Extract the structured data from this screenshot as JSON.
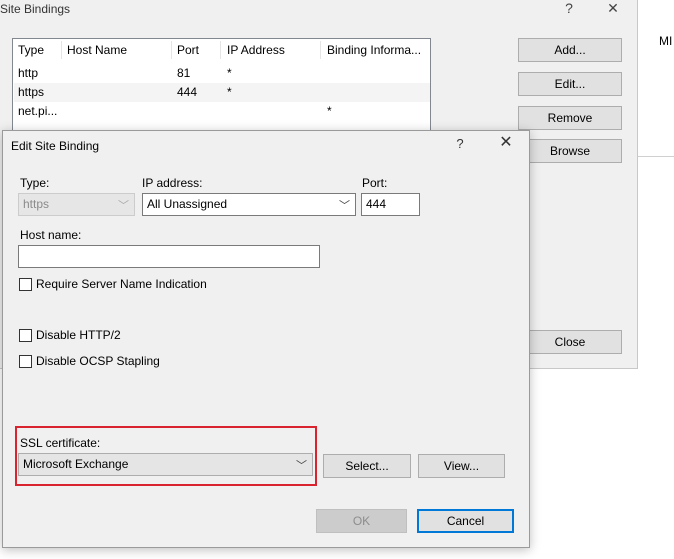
{
  "site_bindings": {
    "title": "Site Bindings",
    "help_glyph": "?",
    "close_glyph": "✕",
    "columns": [
      "Type",
      "Host Name",
      "Port",
      "IP Address",
      "Binding Informa..."
    ],
    "rows": [
      {
        "type": "http",
        "host": "",
        "port": "81",
        "ip": "*",
        "info": ""
      },
      {
        "type": "https",
        "host": "",
        "port": "444",
        "ip": "*",
        "info": ""
      },
      {
        "type": "net.pi...",
        "host": "",
        "port": "",
        "ip": "",
        "info": "*"
      }
    ],
    "buttons": {
      "add": "Add...",
      "edit": "Edit...",
      "remove": "Remove",
      "browse": "Browse",
      "close": "Close"
    }
  },
  "background_text": "MI",
  "edit_dialog": {
    "title": "Edit Site Binding",
    "help_glyph": "?",
    "close_glyph": "✕",
    "type_label": "Type:",
    "type_value": "https",
    "ip_label": "IP address:",
    "ip_value": "All Unassigned",
    "port_label": "Port:",
    "port_value": "444",
    "host_label": "Host name:",
    "host_value": "",
    "sni_label": "Require Server Name Indication",
    "disable_http2_label": "Disable HTTP/2",
    "disable_ocsp_label": "Disable OCSP Stapling",
    "ssl_label": "SSL certificate:",
    "ssl_value": "Microsoft Exchange",
    "select_button": "Select...",
    "view_button": "View...",
    "ok_button": "OK",
    "cancel_button": "Cancel"
  },
  "chevron_glyph": "﹀",
  "colors": {
    "accent": "#0078d7",
    "highlight": "#d9232e"
  }
}
